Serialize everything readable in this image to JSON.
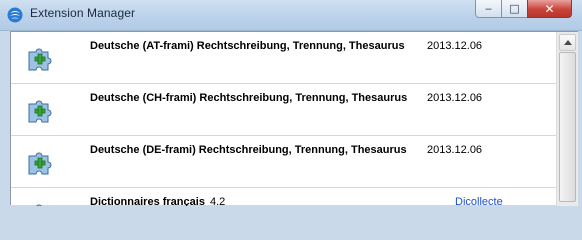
{
  "window": {
    "title": "Extension Manager",
    "controls": {
      "minimize": "‒",
      "maximize": "□",
      "close": "✕"
    }
  },
  "extensions": [
    {
      "name": "Deutsche (AT-frami) Rechtschreibung, Trennung, Thesaurus",
      "version": "2013.12.06",
      "icon": "puzzle-piece-icon"
    },
    {
      "name": "Deutsche (CH-frami) Rechtschreibung, Trennung, Thesaurus",
      "version": "2013.12.06",
      "icon": "puzzle-piece-icon"
    },
    {
      "name": "Deutsche (DE-frami) Rechtschreibung, Trennung, Thesaurus",
      "version": "2013.12.06",
      "icon": "puzzle-piece-icon"
    },
    {
      "name": "Dictionnaires français",
      "version": "4.2",
      "link": "Dicollecte",
      "icon": "puzzle-piece-icon"
    }
  ],
  "colors": {
    "accent_link": "#1a4fd0",
    "close_button": "#c9443a"
  }
}
